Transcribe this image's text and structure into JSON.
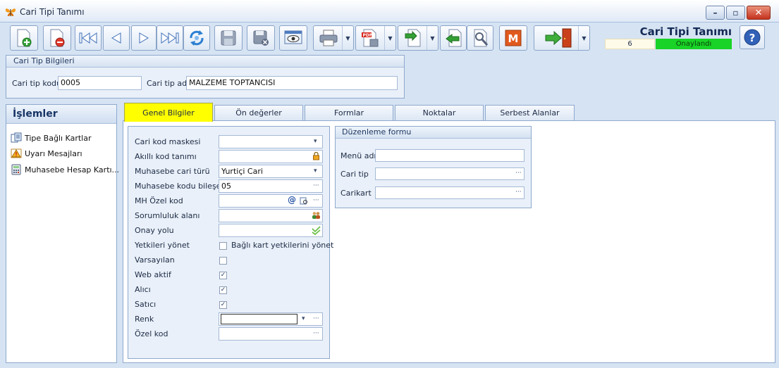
{
  "window": {
    "title": "Cari Tipi Tanımı"
  },
  "header": {
    "title": "Cari Tipi Tanımı",
    "record_number": "6",
    "status": "Onaylandı",
    "status_color": "#19d326"
  },
  "toolbar": {
    "items": [
      "new-icon",
      "delete-icon",
      "first-icon",
      "prev-icon",
      "next-icon",
      "last-icon",
      "refresh-icon",
      "save-icon",
      "save-close-icon",
      "preview-icon",
      "print-icon",
      "pdf-icon",
      "export-icon",
      "import-icon",
      "tools-icon",
      "m-icon",
      "exit-icon"
    ],
    "m_label": "M"
  },
  "group": {
    "title": "Cari Tip Bilgileri",
    "code_label": "Cari tip kodu",
    "code_value": "0005",
    "name_label": "Cari tip adı",
    "name_value": "MALZEME TOPTANCISI"
  },
  "left_panel": {
    "title": "İşlemler",
    "items": [
      {
        "label": "Tipe Bağlı Kartlar",
        "icon": "cards-icon"
      },
      {
        "label": "Uyarı Mesajları",
        "icon": "warning-icon"
      },
      {
        "label": "Muhasebe Hesap Kartı...",
        "icon": "calculator-icon"
      }
    ]
  },
  "tabs": [
    "Genel Bilgiler",
    "Ön değerler",
    "Formlar",
    "Noktalar",
    "Serbest Alanlar"
  ],
  "form": {
    "cari_kod_maskesi": {
      "label": "Cari kod maskesi",
      "value": ""
    },
    "akilli_kod": {
      "label": "Akıllı kod tanımı",
      "value": ""
    },
    "muhasebe_cari_turu": {
      "label": "Muhasebe cari türü",
      "value": "Yurtiçi Cari"
    },
    "muhasebe_kodu": {
      "label": "Muhasebe kodu bileşeni",
      "value": "05"
    },
    "mh_ozel_kod": {
      "label": "MH Özel kod",
      "value": ""
    },
    "sorumluluk": {
      "label": "Sorumluluk alanı",
      "value": ""
    },
    "onay_yolu": {
      "label": "Onay yolu",
      "value": ""
    },
    "yetkileri": {
      "label": "Yetkileri yönet",
      "checkbox_label": "Bağlı kart yetkilerini yönet",
      "checked": false
    },
    "varsayilan": {
      "label": "Varsayılan",
      "checked": false
    },
    "web_aktif": {
      "label": "Web aktif",
      "checked": true
    },
    "alici": {
      "label": "Alıcı",
      "checked": true
    },
    "satici": {
      "label": "Satıcı",
      "checked": true
    },
    "renk": {
      "label": "Renk",
      "value": ""
    },
    "ozel_kod": {
      "label": "Özel kod",
      "value": ""
    },
    "ellipsis": "···",
    "check_mark": "✓",
    "dropdown_arrow": "▾"
  },
  "edit_form": {
    "title": "Düzenleme formu",
    "menu_adi": {
      "label": "Menü adı",
      "value": ""
    },
    "cari_tip": {
      "label": "Cari tip",
      "value": ""
    },
    "carikart": {
      "label": "Carikart",
      "value": ""
    }
  }
}
